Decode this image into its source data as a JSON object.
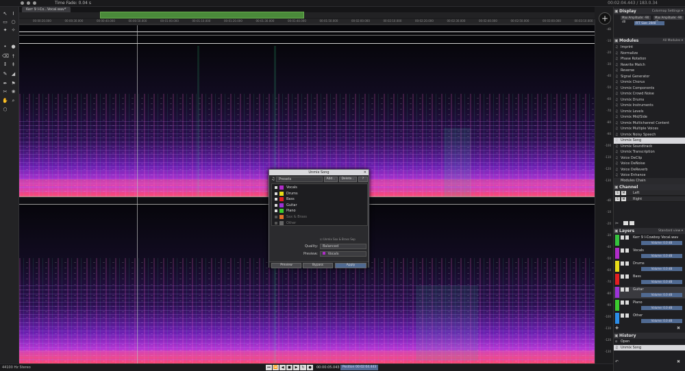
{
  "window": {
    "title": "Time Fade: 0.04 s",
    "clock": "00:02:04.443 / 183.0.34"
  },
  "file_tab": "Kerr 9 I-Co...Vocal.wav*",
  "ruler_ticks": [
    "00:00:20.000",
    "00:00:30.000",
    "00:00:40.000",
    "00:00:50.000",
    "00:01:00.000",
    "00:01:10.000",
    "00:01:20.000",
    "00:01:30.000",
    "00:01:40.000",
    "00:01:50.000",
    "00:02:00.000",
    "00:02:10.000",
    "00:02:20.000",
    "00:02:30.000",
    "00:02:40.000",
    "00:02:50.000",
    "00:03:00.000",
    "00:03:10.000"
  ],
  "scale_labels": [
    "-dB",
    "-10",
    "-20",
    "-30",
    "-40",
    "-50",
    "-60",
    "-70",
    "-80",
    "-90",
    "-100",
    "-110",
    "-120",
    "-130",
    "-dB",
    "-10",
    "-20",
    "-30",
    "-40",
    "-50",
    "-60",
    "-70",
    "-80",
    "-90",
    "-100",
    "-110",
    "-120",
    "-130"
  ],
  "display": {
    "header": "Display",
    "settings": "Colormap Settings ▾",
    "row1a": "Max Amplitude: -90 dB",
    "row1b": "Max Amplitude: -90 dB",
    "row2": "FFT Size: 2048"
  },
  "modules": {
    "header": "Modules",
    "filter": "All Modules ▾",
    "items": [
      "Imprint",
      "Normalize",
      "Phase Rotation",
      "Rewrite Match",
      "Reverse",
      "Signal Generator",
      "Unmix Chorus",
      "Unmix Components",
      "Unmix Crowd Noise",
      "Unmix Drums",
      "Unmix Instruments",
      "Unmix Levels",
      "Unmix Mid/Side",
      "Unmix Multichannel Content",
      "Unmix Multiple Voices",
      "Unmix Noisy Speech",
      "Unmix Song",
      "Unmix Soundtrack",
      "Unmix Transcription",
      "Voice DeClip",
      "Voice DeNoise",
      "Voice DeReverb",
      "Voice Enhance"
    ],
    "selected": "Unmix Song",
    "footer": "Modules Chain"
  },
  "channel": {
    "header": "Channel",
    "rows": [
      "Left",
      "Right"
    ]
  },
  "layers": {
    "header": "Layers",
    "filter": "Standard view ▾",
    "items": [
      {
        "name": "Kerr 9 I-Cowboy Vocal.wav",
        "color": "#35c23d",
        "vol": "Volume: 0.0 dB"
      },
      {
        "name": "Vocals",
        "color": "#b02cc8",
        "vol": "Volume: 0.0 dB"
      },
      {
        "name": "Drums",
        "color": "#e8dc18",
        "vol": "Volume: 0.0 dB"
      },
      {
        "name": "Bass",
        "color": "#e21f22",
        "vol": "Volume: 0.0 dB"
      },
      {
        "name": "Guitar",
        "color": "#9b33d8",
        "vol": "Volume: 0.0 dB"
      },
      {
        "name": "Piano",
        "color": "#3bcc2e",
        "vol": "Volume: 0.0 dB"
      },
      {
        "name": "Other",
        "color": "#2b8de8",
        "vol": "Volume: 0.0 dB"
      }
    ],
    "selected": "Guitar"
  },
  "history": {
    "header": "History",
    "items": [
      "Open",
      "Unmix Song"
    ],
    "selected": "Unmix Song"
  },
  "status": {
    "sample_rate": "44100 Hz Stereo",
    "timecode": "00:00:05.043",
    "selection": "Position 00:02:04.443"
  },
  "dialog": {
    "title": "Unmix Song",
    "preset_label": "Presets",
    "add": "Add...",
    "delete": "Delete...",
    "sources": [
      {
        "name": "Vocals",
        "color": "#b02cc8",
        "checked": true
      },
      {
        "name": "Drums",
        "color": "#e8dc18",
        "checked": true
      },
      {
        "name": "Bass",
        "color": "#e21f22",
        "checked": true
      },
      {
        "name": "Guitar",
        "color": "#9b33d8",
        "checked": true
      },
      {
        "name": "Piano",
        "color": "#3bcc2e",
        "checked": true
      },
      {
        "name": "Sax & Brass",
        "color": "#e0722a",
        "checked": false
      },
      {
        "name": "Other",
        "color": "#666666",
        "checked": false
      }
    ],
    "note": "☑ Unmix Sax & Brass Sep",
    "quality_label": "Quality:",
    "quality_value": "Balanced",
    "preview_label": "Preview:",
    "preview_value": "Vocals",
    "preview_btn": "Preview",
    "bypass_btn": "Bypass",
    "apply_btn": "Apply"
  }
}
